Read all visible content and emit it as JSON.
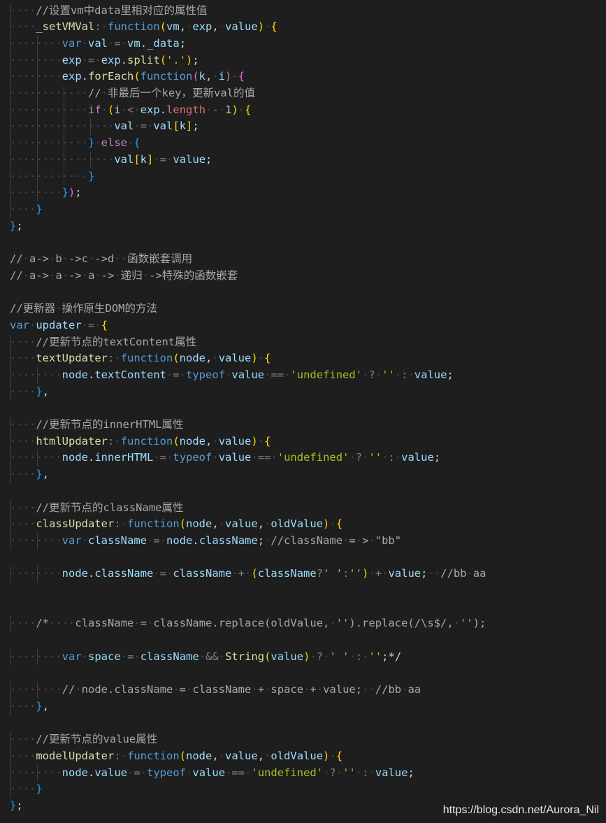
{
  "editor": {
    "language": "javascript",
    "theme_colors": {
      "background": "#1e1e1e",
      "keyword": "#569cd6",
      "control": "#c586c0",
      "function": "#dcdcaa",
      "property": "#9cdcfe",
      "string": "#a8c023",
      "comment": "#a8a8a8"
    },
    "lines": [
      "····//设置vm中data里相对应的属性值",
      "····_setVMVal: function(vm, exp, value) {",
      "········var val = vm._data;",
      "········exp = exp.split('.');",
      "········exp.forEach(function(k, i) {",
      "············// 非最后一个key，更新val的值",
      "············if (i < exp.length - 1) {",
      "················val = val[k];",
      "············} else {",
      "················val[k] = value;",
      "············}",
      "········});",
      "····}",
      "};",
      "",
      "// a-> b ->c ->d  函数嵌套调用",
      "// a-> a -> a -> 递归 ->特殊的函数嵌套",
      "",
      "//更新器 操作原生DOM的方法",
      "var updater = {",
      "····//更新节点的textContent属性",
      "····textUpdater: function(node, value) {",
      "········node.textContent = typeof value == 'undefined' ? '' : value;",
      "····},",
      "",
      "····//更新节点的innerHTML属性",
      "····htmlUpdater: function(node, value) {",
      "········node.innerHTML = typeof value == 'undefined' ? '' : value;",
      "····},",
      "",
      "····//更新节点的className属性",
      "····classUpdater: function(node, value, oldValue) {",
      "········var className = node.className; //className = > \"bb\"",
      "",
      "········node.className = className + (className?' ':'') + value;  //bb aa",
      "",
      "",
      "····/*    className = className.replace(oldValue, '').replace(/\\s$/, '');",
      "",
      "········var space = className && String(value) ? ' ' : '';*/",
      "",
      "········// node.className = className + space + value;  //bb aa",
      "····},",
      "",
      "····//更新节点的value属性",
      "····modelUpdater: function(node, value, oldValue) {",
      "········node.value = typeof value == 'undefined' ? '' : value;",
      "····}",
      "};"
    ]
  },
  "watermark": "https://blog.csdn.net/Aurora_Nil"
}
